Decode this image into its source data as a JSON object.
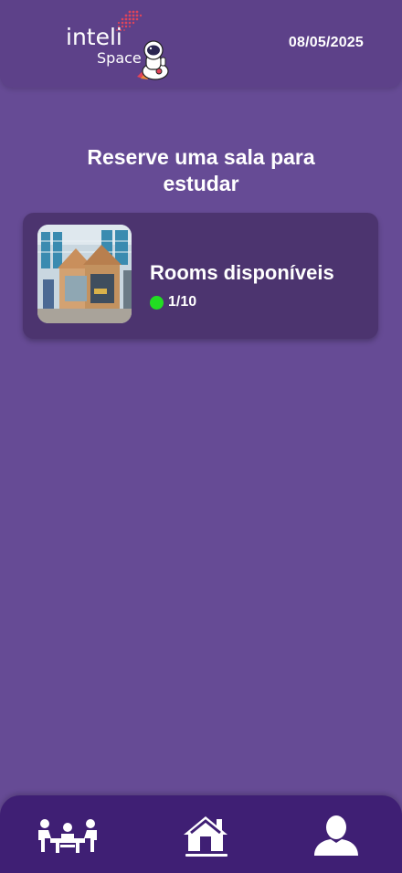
{
  "header": {
    "logo_text_primary": "inteli",
    "logo_text_secondary": "Space",
    "date": "08/05/2025"
  },
  "main": {
    "title": "Reserve uma sala para estudar",
    "room_card": {
      "title": "Rooms disponíveis",
      "availability": "1/10",
      "status_color": "#22dd22",
      "image_icon": "room-photo"
    }
  },
  "bottom_nav": {
    "items": [
      {
        "icon": "meeting-table-icon",
        "active": false
      },
      {
        "icon": "home-icon",
        "active": true
      },
      {
        "icon": "user-profile-icon",
        "active": false
      }
    ]
  },
  "colors": {
    "background": "#664b95",
    "header": "#5d4189",
    "card": "#4c346f",
    "nav": "#3f1f74",
    "accent_logo": "#e0445a"
  }
}
